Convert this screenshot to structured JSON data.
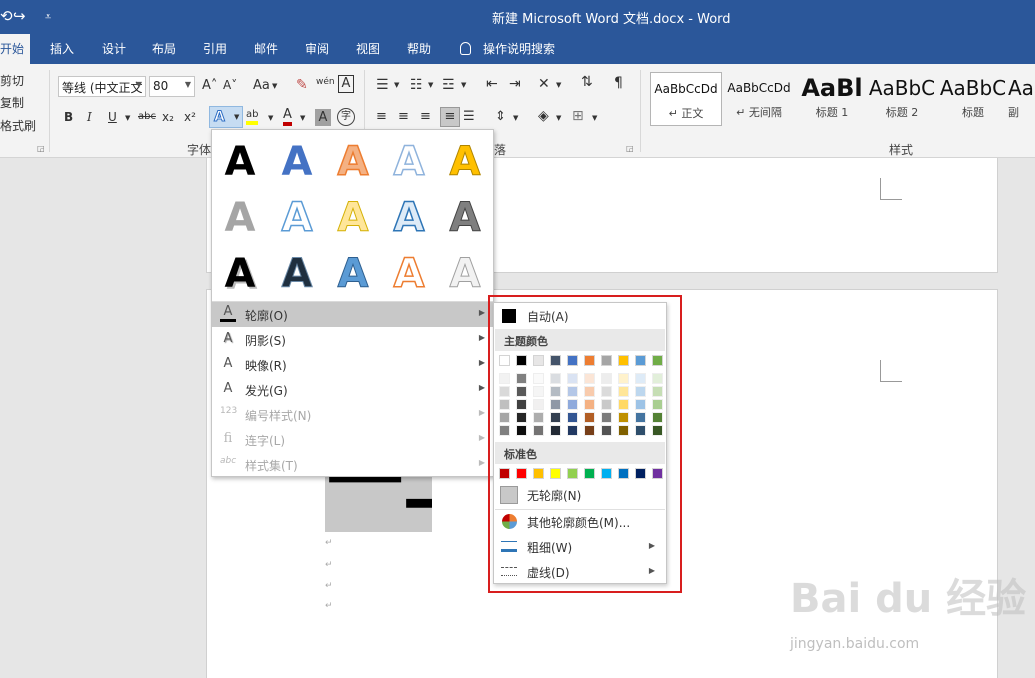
{
  "title_bar": {
    "title": "新建 Microsoft Word 文档.docx  -  Word",
    "undo_icon": "⟲",
    "redo_icon": "↪",
    "customize_icon": "⩡"
  },
  "tabs": [
    "开始",
    "插入",
    "设计",
    "布局",
    "引用",
    "邮件",
    "审阅",
    "视图",
    "帮助"
  ],
  "tell_me": "操作说明搜索",
  "clipboard": {
    "cut": "剪切",
    "copy": "复制",
    "format_painter": "格式刷"
  },
  "font": {
    "font_name": "等线 (中文正文",
    "font_size": "80",
    "grow": "A˄",
    "shrink": "A˅",
    "case": "Aa",
    "clear": "✎",
    "phonetic": "wén",
    "border_char": "A",
    "bold": "B",
    "italic": "I",
    "underline": "U",
    "strike": "abc",
    "subscript": "x₂",
    "superscript": "x²",
    "effects": "A",
    "highlight": "ab",
    "font_color": "A",
    "shading_char": "A",
    "enclose_char": "字"
  },
  "group_labels": {
    "font": "字体",
    "paragraph": "落",
    "styles": "样式"
  },
  "styles": [
    {
      "preview": "AaBbCcDd",
      "name": "↵ 正文"
    },
    {
      "preview": "AaBbCcDd",
      "name": "↵ 无间隔"
    },
    {
      "preview": "AaBl",
      "name": "标题 1"
    },
    {
      "preview": "AaBbC",
      "name": "标题 2"
    },
    {
      "preview": "AaBbC",
      "name": "标题"
    },
    {
      "preview": "Aa",
      "name": "副"
    }
  ],
  "effects_menu": {
    "gallery_letter": "A",
    "items": [
      {
        "icon": "A",
        "label": "轮廓(O)",
        "state": "hover"
      },
      {
        "icon": "A",
        "label": "阴影(S)",
        "state": "normal"
      },
      {
        "icon": "A",
        "label": "映像(R)",
        "state": "normal"
      },
      {
        "icon": "A",
        "label": "发光(G)",
        "state": "normal"
      },
      {
        "icon": "123",
        "label": "编号样式(N)",
        "state": "disabled"
      },
      {
        "icon": "fi",
        "label": "连字(L)",
        "state": "disabled"
      },
      {
        "icon": "abc",
        "label": "样式集(T)",
        "state": "disabled"
      }
    ]
  },
  "outline_menu": {
    "auto": "自动(A)",
    "theme_colors_heading": "主题颜色",
    "standard_colors_heading": "标准色",
    "no_outline": "无轮廓(N)",
    "more_colors": "其他轮廓颜色(M)...",
    "weight": "粗细(W)",
    "dashes": "虚线(D)",
    "theme_colors": [
      "#ffffff",
      "#000000",
      "#e7e6e6",
      "#44546a",
      "#4472c4",
      "#ed7d31",
      "#a5a5a5",
      "#ffc000",
      "#5b9bd5",
      "#70ad47"
    ],
    "standard_colors": [
      "#c00000",
      "#ff0000",
      "#ffc000",
      "#ffff00",
      "#92d050",
      "#00b050",
      "#00b0f0",
      "#0070c0",
      "#002060",
      "#7030a0"
    ]
  },
  "colors": {
    "accent": "#2b579a",
    "highlight_frame": "#d81e1e",
    "menu_hover": "#c8c8c8"
  },
  "document": {
    "visible_text": "一二"
  },
  "watermark": {
    "brand": "Bai du 经验",
    "url": "jingyan.baidu.com"
  }
}
